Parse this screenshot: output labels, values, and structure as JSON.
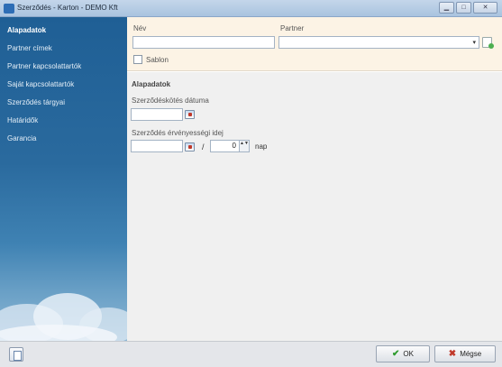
{
  "window": {
    "app_icon": "app-logo-icon",
    "title": "Szerződés - Karton  - DEMO Kft",
    "controls": {
      "minimize": "▁",
      "maximize": "□",
      "close": "✕"
    }
  },
  "sidebar": {
    "items": [
      {
        "label": "Alapadatok",
        "active": true
      },
      {
        "label": "Partner címek"
      },
      {
        "label": "Partner kapcsolattartók"
      },
      {
        "label": "Saját kapcsolattartók"
      },
      {
        "label": "Szerződés tárgyai"
      },
      {
        "label": "Határidők"
      },
      {
        "label": "Garancia"
      }
    ]
  },
  "header_form": {
    "nev_label": "Név",
    "nev_value": "",
    "partner_label": "Partner",
    "partner_value": "",
    "partner_arrow": "▾",
    "sablon_label": "Sablon",
    "sablon_checked": false
  },
  "main": {
    "section_title": "Alapadatok",
    "kotes_label": "Szerződéskötés dátuma",
    "kotes_value": "",
    "ervenyesseg_label": "Szerződés érvényességi idej",
    "ervenyesseg_value": "",
    "slash": "/",
    "spinner_value": "0",
    "spinner_arrows": "▲▼",
    "nap_label": "nap"
  },
  "footer": {
    "ok_label": "OK",
    "ok_icon": "✔",
    "cancel_label": "Mégse",
    "cancel_icon": "✖"
  },
  "colors": {
    "sidebar_top": "#1f5f95",
    "header_bg": "#fcf3e5",
    "content_bg": "#f0f0f0"
  }
}
